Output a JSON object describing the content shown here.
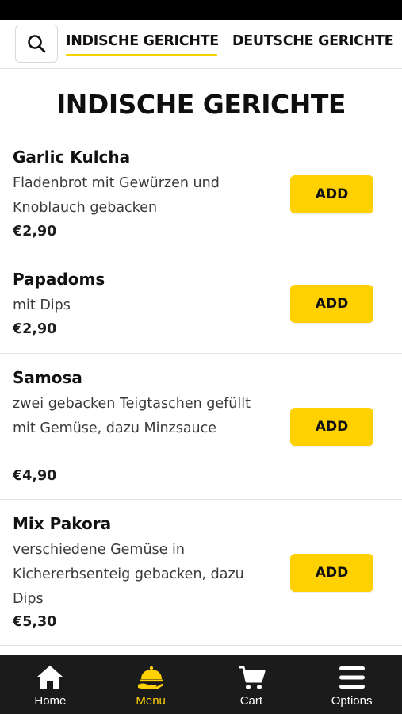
{
  "colors": {
    "accent": "#ffd100",
    "nav_background": "#1b1b1b",
    "status_bar": "#000000"
  },
  "tabs": [
    {
      "label": "INDISCHE GERICHTE",
      "active": true
    },
    {
      "label": "DEUTSCHE GERICHTE",
      "active": false
    }
  ],
  "search": {
    "icon": "search-icon"
  },
  "section": {
    "title": "INDISCHE GERICHTE"
  },
  "items": [
    {
      "name": "Garlic Kulcha",
      "description": "Fladenbrot mit Gewürzen und Knoblauch gebacken",
      "price": "€2,90",
      "button": "ADD"
    },
    {
      "name": "Papadoms",
      "description": "mit Dips",
      "price": "€2,90",
      "button": "ADD"
    },
    {
      "name": "Samosa",
      "description": "zwei gebacken Teigtaschen gefüllt mit Gemüse, dazu Minzsauce",
      "price": "€4,90",
      "button": "ADD"
    },
    {
      "name": "Mix Pakora",
      "description": "verschiedene Gemüse in Kichererbsenteig gebacken, dazu Dips",
      "price": "€5,30",
      "button": "ADD"
    }
  ],
  "nav": [
    {
      "label": "Home",
      "icon": "home-icon",
      "active": false
    },
    {
      "label": "Menu",
      "icon": "cloche-icon",
      "active": true
    },
    {
      "label": "Cart",
      "icon": "cart-icon",
      "active": false
    },
    {
      "label": "Options",
      "icon": "hamburger-menu-icon",
      "active": false
    }
  ]
}
